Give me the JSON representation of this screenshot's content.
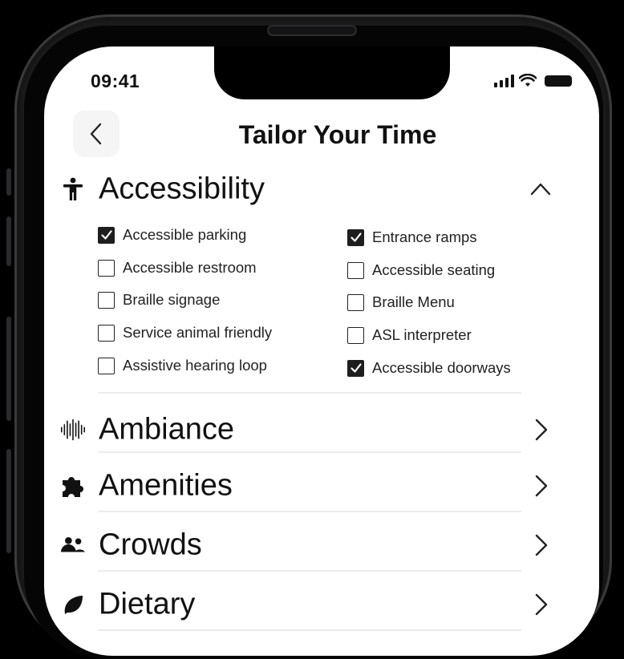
{
  "status_bar": {
    "time": "09:41"
  },
  "header": {
    "title": "Tailor Your Time"
  },
  "accessibility": {
    "label": "Accessibility",
    "options": [
      {
        "label": "Accessible parking",
        "checked": true
      },
      {
        "label": "Accessible restroom",
        "checked": false
      },
      {
        "label": "Braille signage",
        "checked": false
      },
      {
        "label": "Service animal friendly",
        "checked": false
      },
      {
        "label": "Assistive hearing loop",
        "checked": false
      },
      {
        "label": "Entrance ramps",
        "checked": true
      },
      {
        "label": "Accessible seating",
        "checked": false
      },
      {
        "label": "Braille Menu",
        "checked": false
      },
      {
        "label": "ASL interpreter",
        "checked": false
      },
      {
        "label": "Accessible doorways",
        "checked": true
      }
    ]
  },
  "sections": [
    {
      "label": "Ambiance",
      "icon": "soundwave-icon"
    },
    {
      "label": "Amenities",
      "icon": "puzzle-icon"
    },
    {
      "label": "Crowds",
      "icon": "people-icon"
    },
    {
      "label": "Dietary",
      "icon": "leaf-icon"
    }
  ]
}
